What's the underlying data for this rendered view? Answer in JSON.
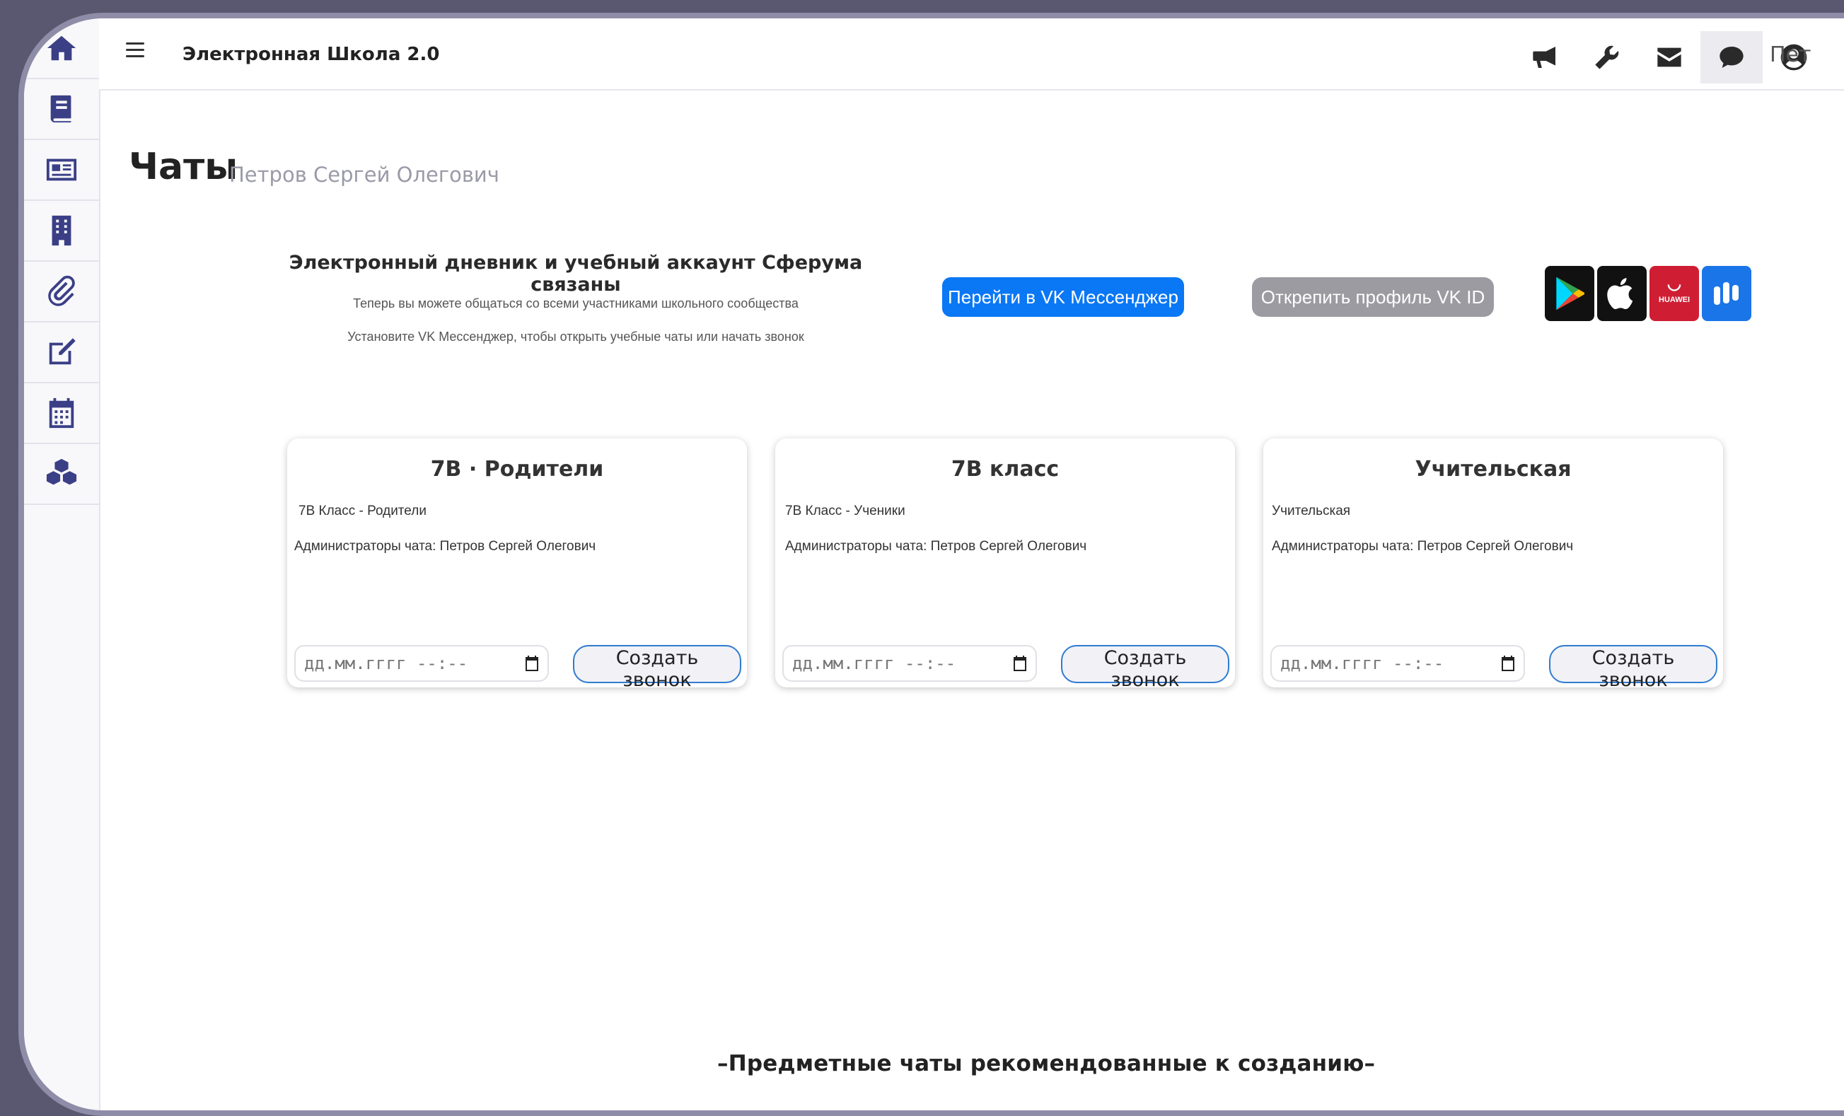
{
  "app": {
    "title": "Электронная Школа 2.0",
    "user_name_truncated": "Пет"
  },
  "page": {
    "title": "Чаты",
    "subtitle": "Петров Сергей Олегович"
  },
  "banner": {
    "title": "Электронный дневник и учебный аккаунт Сферума связаны",
    "line1": "Теперь вы можете общаться со всеми участниками школьного сообщества",
    "line2": "Установите VK Мессенджер, чтобы открыть учебные чаты или начать звонок",
    "vk_button": "Перейти в VK Мессенджер",
    "unlink_button": "Открепить профиль VK ID",
    "huawei_label": "HUAWEI"
  },
  "cards": [
    {
      "title": "7В · Родители",
      "desc": "7В Класс - Родители",
      "admins": "Администраторы чата: Петров Сергей Олегович",
      "date_placeholder": "дд.мм.гггг --:--",
      "call_button": "Создать звонок"
    },
    {
      "title": "7В класс",
      "desc": "7В Класс - Ученики",
      "admins": "Администраторы чата: Петров Сергей Олегович",
      "date_placeholder": "дд.мм.гггг --:--",
      "call_button": "Создать звонок"
    },
    {
      "title": "Учительская",
      "desc": "Учительская",
      "admins": "Администраторы чата: Петров Сергей Олегович",
      "date_placeholder": "дд.мм.гггг --:--",
      "call_button": "Создать звонок"
    }
  ],
  "bottom": {
    "title": "–Предметные чаты рекомендованные к созданию–"
  },
  "colors": {
    "accent": "#0a77f5",
    "sidebar_icon": "#3a3f86",
    "unlink": "#9b9ba1",
    "huawei": "#cf1e33",
    "rustore": "#1a75e8"
  },
  "icons": {
    "sidebar": [
      "home-icon",
      "book-icon",
      "newspaper-icon",
      "building-icon",
      "paperclip-icon",
      "edit-icon",
      "calendar-icon",
      "cubes-icon"
    ],
    "topbar": [
      "bullhorn-icon",
      "wrench-icon",
      "envelope-icon",
      "comment-icon",
      "user-circle-icon"
    ]
  }
}
